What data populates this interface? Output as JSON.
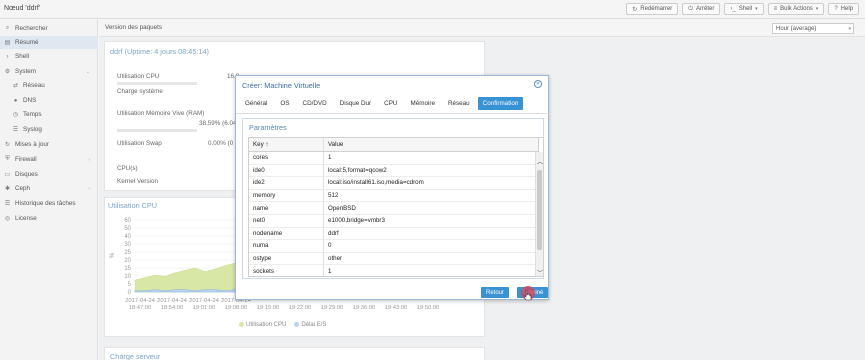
{
  "node": {
    "title": "Nœud 'ddrf'"
  },
  "topbar": {
    "restart": "Redémarrer",
    "shutdown": "Arrêter",
    "shell": "Shell",
    "bulk": "Bulk Actions",
    "help": "Help"
  },
  "sidebar": {
    "items": [
      {
        "label": "Rechercher",
        "icon": "search-icon"
      },
      {
        "label": "Résumé",
        "icon": "summary-icon"
      },
      {
        "label": "Shell",
        "icon": "terminal-icon"
      },
      {
        "label": "System",
        "icon": "gear-icon"
      },
      {
        "label": "Réseau",
        "icon": "network-icon"
      },
      {
        "label": "DNS",
        "icon": "globe-icon"
      },
      {
        "label": "Temps",
        "icon": "clock-icon"
      },
      {
        "label": "Syslog",
        "icon": "list-icon"
      },
      {
        "label": "Mises à jour",
        "icon": "refresh-icon"
      },
      {
        "label": "Firewall",
        "icon": "shield-icon"
      },
      {
        "label": "Disques",
        "icon": "disk-icon"
      },
      {
        "label": "Ceph",
        "icon": "ceph-icon"
      },
      {
        "label": "Historique des tâches",
        "icon": "list-icon"
      },
      {
        "label": "License",
        "icon": "support-icon"
      }
    ]
  },
  "toolbar": {
    "packages": "Version des paquets",
    "timeframe": "Hour (average)"
  },
  "summary": {
    "title": "ddrf (Uptime: 4 jours 08:45:14)",
    "cpu_label": "Utilisation CPU",
    "cpu_value": "16.0",
    "load_label": "Charge système",
    "mem_label": "Utilisation Mémoire Vive (RAM)",
    "mem_value": "38.59% (6.04",
    "swap_label": "Utilisation Swap",
    "swap_value": "0.00% (0 ",
    "cpus_label": "CPU(s)",
    "kernel_label": "Kernel Version"
  },
  "cpu_chart": {
    "title": "Utilisation CPU",
    "legend_cpu": "Utilisation CPU",
    "legend_io": "Délai E/S",
    "colors": {
      "cpu": "#d9e7a6",
      "io": "#b9d3ee"
    }
  },
  "chart_data": {
    "type": "area",
    "title": "Utilisation CPU",
    "ylabel": "%",
    "ylim": [
      0,
      60
    ],
    "yticks": [
      "60",
      "50",
      "40",
      "30",
      "25",
      "20",
      "15",
      "10",
      "5",
      "0"
    ],
    "xticks": [
      [
        "2017-04-24",
        "18:47:00"
      ],
      [
        "2017-04-24",
        "18:54:00"
      ],
      [
        "2017-04-24",
        "19:01:00"
      ],
      [
        "2017-04-24",
        "19:08:00"
      ],
      [
        "",
        "19:15:00"
      ],
      [
        "",
        "19:22:00"
      ],
      [
        "",
        "19:29:00"
      ],
      [
        "",
        "19:36:00"
      ],
      [
        "",
        "19:43:00"
      ],
      [
        "",
        "19:50:00"
      ]
    ],
    "series": [
      {
        "name": "Utilisation CPU",
        "values": [
          10,
          12,
          14,
          13,
          16,
          18,
          20,
          17,
          19,
          22,
          24,
          23
        ]
      },
      {
        "name": "Délai E/S",
        "values": [
          1,
          1,
          2,
          1,
          2,
          2,
          1,
          2,
          2,
          1,
          2,
          1
        ]
      }
    ]
  },
  "bottom_panel": {
    "title": "Charge serveur"
  },
  "modal": {
    "title": "Créer: Machine Virtuelle",
    "tabs": [
      "Général",
      "OS",
      "CD/DVD",
      "Disque Dur",
      "CPU",
      "Mémoire",
      "Réseau",
      "Confirmation"
    ],
    "active_tab": "Confirmation",
    "section": "Paramètres",
    "col_key": "Key ↑",
    "col_value": "Value",
    "rows": [
      {
        "key": "cores",
        "value": "1"
      },
      {
        "key": "ide0",
        "value": "local:5,format=qcow2"
      },
      {
        "key": "ide2",
        "value": "local:iso/install61.iso,media=cdrom"
      },
      {
        "key": "memory",
        "value": "512"
      },
      {
        "key": "name",
        "value": "OpenBSD"
      },
      {
        "key": "net0",
        "value": "e1000,bridge=vmbr3"
      },
      {
        "key": "nodename",
        "value": "ddrf"
      },
      {
        "key": "numa",
        "value": "0"
      },
      {
        "key": "ostype",
        "value": "other"
      },
      {
        "key": "sockets",
        "value": "1"
      }
    ],
    "back": "Retour",
    "finish": "Terminé"
  }
}
